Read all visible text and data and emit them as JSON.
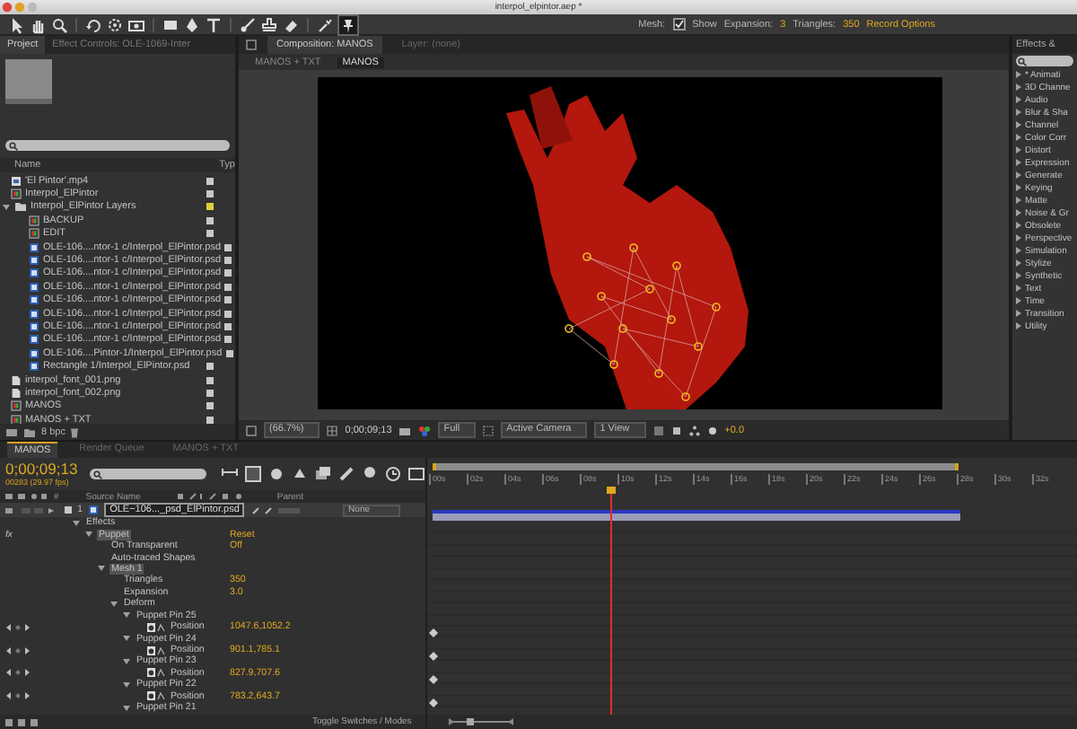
{
  "window": {
    "title": "interpol_elpintor.aep *"
  },
  "toolbar": {
    "mesh_label": "Mesh:",
    "show": {
      "label": "Show",
      "checked": true
    },
    "expansion": {
      "label": "Expansion:",
      "value": "3"
    },
    "triangles": {
      "label": "Triangles:",
      "value": "350"
    },
    "record_options": "Record Options"
  },
  "project_panel": {
    "tabs": [
      {
        "label": "Project",
        "selected": true
      },
      {
        "label": "Effect Controls: OLE-1069-Inter",
        "selected": false
      }
    ],
    "columns": [
      "Name",
      "Typ"
    ],
    "items": [
      {
        "name": "'El Pintor'.mp4",
        "kind": "footage",
        "color": "#c8c8c8"
      },
      {
        "name": "Interpol_ElPintor",
        "kind": "comp",
        "color": "#c8c8c8"
      },
      {
        "name": "Interpol_ElPintor Layers",
        "kind": "folder",
        "color": "#e2cf3a",
        "expanded": true,
        "children": [
          {
            "name": "BACKUP",
            "kind": "comp",
            "color": "#c8c8c8"
          },
          {
            "name": "EDIT",
            "kind": "comp",
            "color": "#c8c8c8"
          },
          {
            "name": "OLE-106....ntor-1 c/Interpol_ElPintor.psd",
            "kind": "psd",
            "color": "#c8c8c8"
          },
          {
            "name": "OLE-106....ntor-1 c/Interpol_ElPintor.psd",
            "kind": "psd",
            "color": "#c8c8c8"
          },
          {
            "name": "OLE-106....ntor-1 c/Interpol_ElPintor.psd",
            "kind": "psd",
            "color": "#c8c8c8"
          },
          {
            "name": "OLE-106....ntor-1 c/Interpol_ElPintor.psd",
            "kind": "psd",
            "color": "#c8c8c8"
          },
          {
            "name": "OLE-106....ntor-1 c/Interpol_ElPintor.psd",
            "kind": "psd",
            "color": "#c8c8c8"
          },
          {
            "name": "OLE-106....ntor-1 c/Interpol_ElPintor.psd",
            "kind": "psd",
            "color": "#c8c8c8"
          },
          {
            "name": "OLE-106....ntor-1 c/Interpol_ElPintor.psd",
            "kind": "psd",
            "color": "#c8c8c8"
          },
          {
            "name": "OLE-106....ntor-1 c/Interpol_ElPintor.psd",
            "kind": "psd",
            "color": "#c8c8c8"
          },
          {
            "name": "OLE-106....Pintor-1/Interpol_ElPintor.psd",
            "kind": "psd",
            "color": "#c8c8c8"
          },
          {
            "name": "Rectangle 1/Interpol_ElPintor.psd",
            "kind": "psd",
            "color": "#c8c8c8"
          }
        ]
      },
      {
        "name": "interpol_font_001.png",
        "kind": "png",
        "color": "#c8c8c8"
      },
      {
        "name": "interpol_font_002.png",
        "kind": "png",
        "color": "#c8c8c8"
      },
      {
        "name": "MANOS",
        "kind": "comp",
        "color": "#c8c8c8"
      },
      {
        "name": "MANOS + TXT",
        "kind": "comp",
        "color": "#c8c8c8"
      }
    ],
    "bit_depth": "8 bpc"
  },
  "composition_panel": {
    "tabs": [
      {
        "label": "Composition: MANOS",
        "selected": true
      },
      {
        "label": "Layer: (none)",
        "selected": false
      }
    ],
    "breadcrumbs": [
      {
        "label": "MANOS + TXT",
        "selected": false
      },
      {
        "label": "MANOS",
        "selected": true
      }
    ],
    "footer": {
      "zoom": "(66.7%)",
      "timecode": "0;00;09;13",
      "resolution": "Full",
      "camera": "Active Camera",
      "views": "1 View",
      "exposure": "+0.0"
    }
  },
  "effects_panel": {
    "title": "Effects &",
    "categories": [
      "* Animati",
      "3D Channe",
      "Audio",
      "Blur & Sha",
      "Channel",
      "Color Corr",
      "Distort",
      "Expression",
      "Generate",
      "Keying",
      "Matte",
      "Noise & Gr",
      "Obsolete",
      "Perspective",
      "Simulation",
      "Stylize",
      "Synthetic",
      "Text",
      "Time",
      "Transition",
      "Utility"
    ]
  },
  "timeline": {
    "tabs": [
      {
        "label": "MANOS",
        "selected": true
      },
      {
        "label": "Render Queue",
        "selected": false
      },
      {
        "label": "MANOS + TXT",
        "selected": false
      }
    ],
    "timecode": "0;00;09;13",
    "frame_info": "00283 (29.97 fps)",
    "columns": [
      "#",
      "Source Name",
      "Parent"
    ],
    "layer": {
      "number": "1",
      "name": "OLE~106..._psd_ElPintor.psd",
      "parent": "None"
    },
    "ruler": [
      "00s",
      "02s",
      "04s",
      "06s",
      "08s",
      "10s",
      "12s",
      "14s",
      "16s",
      "18s",
      "20s",
      "22s",
      "24s",
      "26s",
      "28s",
      "30s",
      "32s"
    ],
    "playhead": {
      "level": 0.286
    },
    "properties": [
      {
        "label": "Effects",
        "selected": false,
        "expanded": true,
        "children": [
          {
            "label": "Puppet",
            "value": "Reset",
            "badge": "fx",
            "selected": true,
            "expanded": true,
            "children": [
              {
                "label": "On Transparent",
                "value": "Off",
                "selected": false
              },
              {
                "label": "Auto-traced Shapes",
                "selected": false
              },
              {
                "label": "Mesh 1",
                "selected": true,
                "expanded": true,
                "children": [
                  {
                    "label": "Triangles",
                    "value": "350",
                    "selected": false
                  },
                  {
                    "label": "Expansion",
                    "value": "3.0",
                    "selected": false
                  },
                  {
                    "label": "Deform",
                    "selected": false,
                    "expanded": true,
                    "children": [
                      {
                        "label": "Puppet Pin 25",
                        "selected": false,
                        "expanded": true,
                        "children": [
                          {
                            "label": "Position",
                            "value": "1047.6,1052.2",
                            "keyframe": true,
                            "selected": false
                          }
                        ]
                      },
                      {
                        "label": "Puppet Pin 24",
                        "selected": false,
                        "expanded": true,
                        "children": [
                          {
                            "label": "Position",
                            "value": "901.1,785.1",
                            "keyframe": true,
                            "selected": false
                          }
                        ]
                      },
                      {
                        "label": "Puppet Pin 23",
                        "selected": false,
                        "expanded": true,
                        "children": [
                          {
                            "label": "Position",
                            "value": "827.9,707.6",
                            "keyframe": true,
                            "selected": false
                          }
                        ]
                      },
                      {
                        "label": "Puppet Pin 22",
                        "selected": false,
                        "expanded": true,
                        "children": [
                          {
                            "label": "Position",
                            "value": "783.2,643.7",
                            "keyframe": true,
                            "selected": false
                          }
                        ]
                      },
                      {
                        "label": "Puppet Pin 21",
                        "selected": false,
                        "expanded": true
                      }
                    ]
                  }
                ]
              }
            ]
          }
        ]
      }
    ],
    "footer": "Toggle Switches / Modes"
  }
}
